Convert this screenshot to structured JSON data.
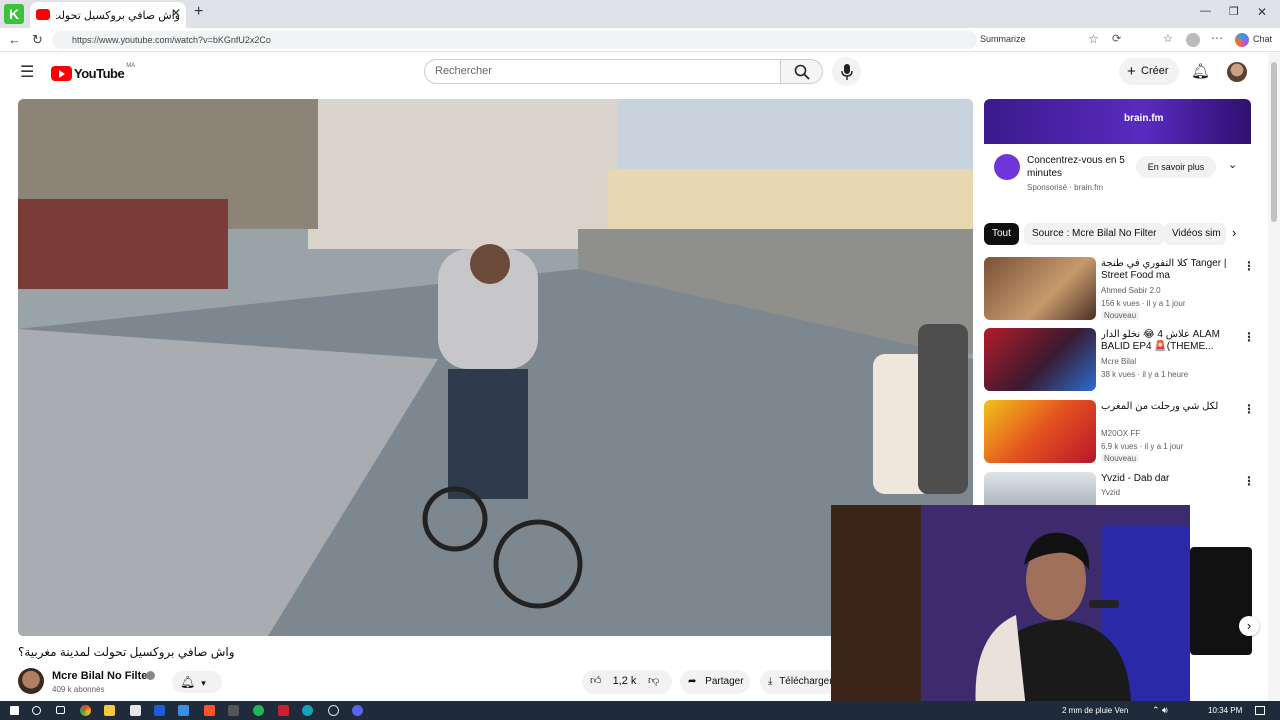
{
  "browser": {
    "tab_title": "واش صافي بروكسيل تحولت لمدينة",
    "url": "https://www.youtube.com/watch?v=bKGnfU2x2Co",
    "toolbar_summarize": "Summarize",
    "toolbar_chat": "Chat"
  },
  "header": {
    "logo_text": "YouTube",
    "region": "MA",
    "search_placeholder": "Rechercher",
    "create_label": "Créer"
  },
  "video": {
    "title": "واش صافي بروكسيل تحولت لمدينة مغربية؟",
    "channel_name": "Mcre Bilal No Filter",
    "subscribers": "409 k abonnés",
    "likes": "1,2 k",
    "share_label": "Partager",
    "download_label": "Télécharger"
  },
  "ad": {
    "brand": "brain.fm",
    "headline": "Concentrez-vous en 5 minutes",
    "sponsored": "Sponsorisé · brain.fm",
    "cta": "En savoir plus"
  },
  "chips": [
    "Tout",
    "Source : Mcre Bilal No Filter",
    "Vidéos sim"
  ],
  "recommendations": [
    {
      "title": "كلا التفوري في طنجة Tanger | Street Food ma",
      "channel": "Ahmed Sabir 2.0",
      "meta": "156 k vues · il y a 1 jour",
      "badge": "Nouveau"
    },
    {
      "title": "علاش 4 😂 نخلو الدار ALAM BALID EP4 🚨(THEME...",
      "channel": "Mcre Bilal",
      "meta": "38 k vues · il y a 1 heure",
      "badge": ""
    },
    {
      "title": "لكل شي ورحلت من المغرب",
      "channel": "M20OX FF",
      "meta": "6,9 k vues · il y a 1 jour",
      "badge": "Nouveau"
    },
    {
      "title": "Yvzid - Dab dar",
      "channel": "Yvzid",
      "meta": "",
      "badge": ""
    }
  ],
  "taskbar": {
    "weather": "2 mm de pluie Ven",
    "time": "10:34 PM"
  }
}
